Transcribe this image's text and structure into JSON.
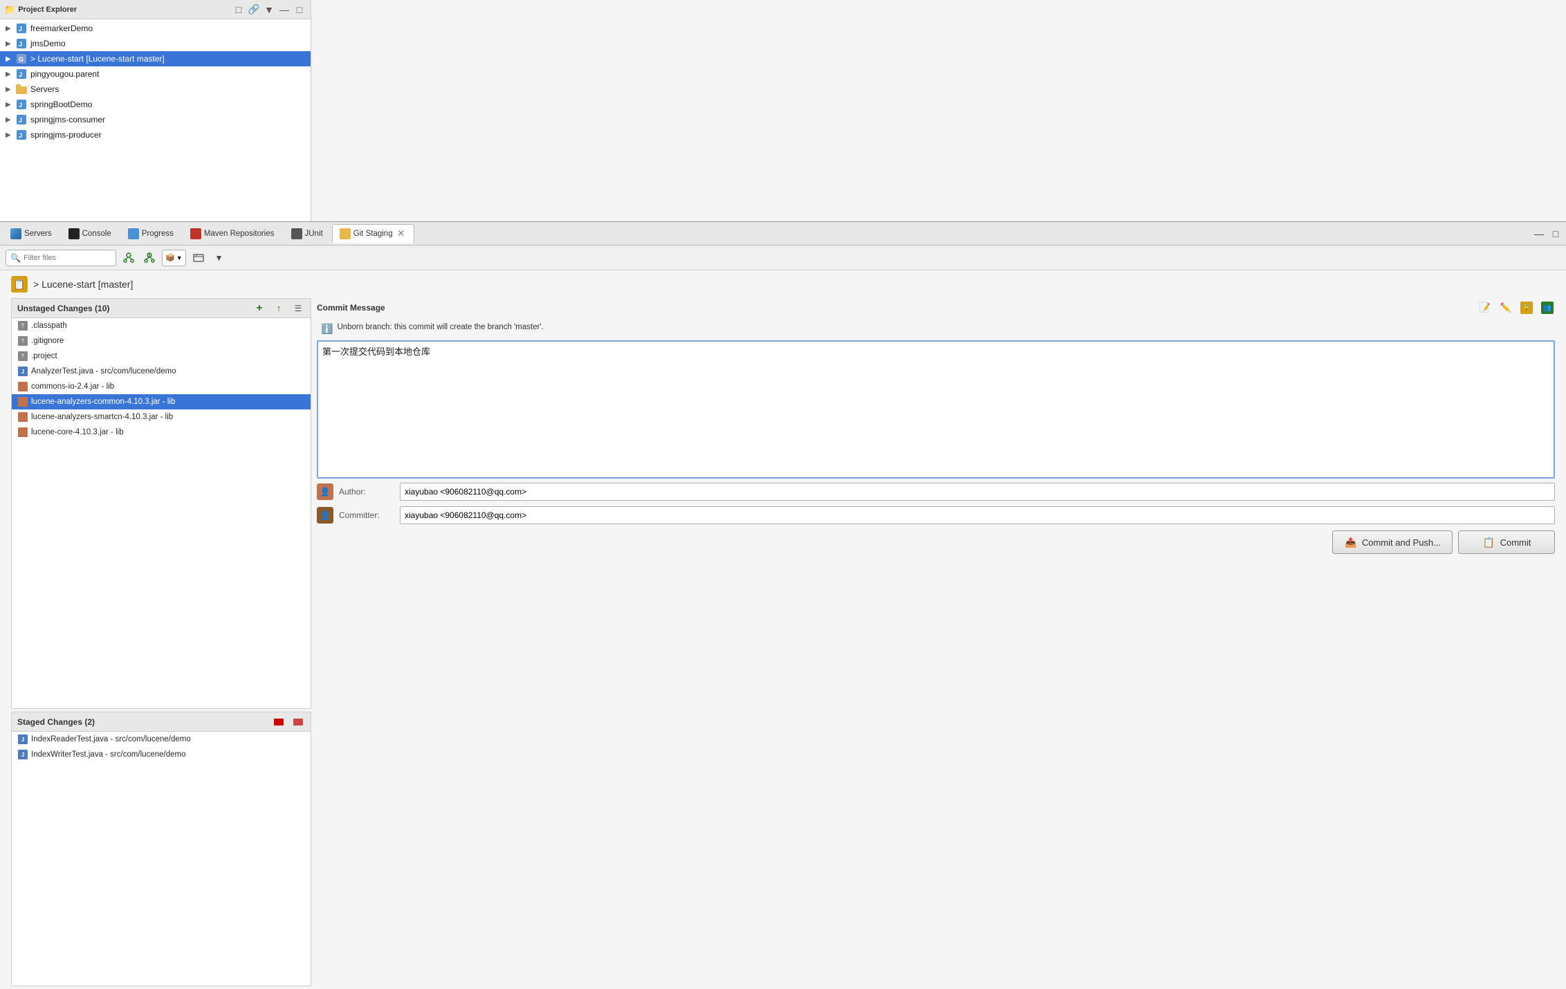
{
  "projectExplorer": {
    "title": "Project Explorer",
    "items": [
      {
        "label": "freemarkerDemo",
        "type": "project",
        "expanded": false
      },
      {
        "label": "jmsDemo",
        "type": "project",
        "expanded": false
      },
      {
        "label": "> Lucene-start [Lucene-start master]",
        "type": "git-project",
        "expanded": false,
        "selected": true
      },
      {
        "label": "pingyougou.parent",
        "type": "project",
        "expanded": false
      },
      {
        "label": "Servers",
        "type": "folder",
        "expanded": false
      },
      {
        "label": "springBootDemo",
        "type": "project",
        "expanded": false
      },
      {
        "label": "springjms-consumer",
        "type": "project",
        "expanded": false
      },
      {
        "label": "springjms-producer",
        "type": "project",
        "expanded": false
      }
    ]
  },
  "tabs": [
    {
      "label": "Servers",
      "type": "servers",
      "active": false
    },
    {
      "label": "Console",
      "type": "console",
      "active": false
    },
    {
      "label": "Progress",
      "type": "progress",
      "active": false
    },
    {
      "label": "Maven Repositories",
      "type": "maven",
      "active": false
    },
    {
      "label": "JUnit",
      "type": "junit",
      "active": false
    },
    {
      "label": "Git Staging",
      "type": "gitstaging",
      "active": true
    }
  ],
  "toolbar": {
    "filterPlaceholder": "Filter files",
    "minimizeLabel": "Minimize",
    "maximizeLabel": "Maximize"
  },
  "branchHeader": {
    "label": "> Lucene-start [master]"
  },
  "unstagedChanges": {
    "title": "Unstaged Changes (10)",
    "files": [
      {
        "name": ".classpath",
        "type": "txt"
      },
      {
        "name": ".gitignore",
        "type": "txt"
      },
      {
        "name": ".project",
        "type": "txt"
      },
      {
        "name": "AnalyzerTest.java - src/com/lucene/demo",
        "type": "java"
      },
      {
        "name": "commons-io-2.4.jar - lib",
        "type": "jar"
      },
      {
        "name": "lucene-analyzers-common-4.10.3.jar - lib",
        "type": "jar",
        "selected": true
      },
      {
        "name": "lucene-analyzers-smartcn-4.10.3.jar - lib",
        "type": "jar"
      },
      {
        "name": "lucene-core-4.10.3.jar - lib",
        "type": "jar"
      }
    ]
  },
  "stagedChanges": {
    "title": "Staged Changes (2)",
    "files": [
      {
        "name": "IndexReaderTest.java - src/com/lucene/demo",
        "type": "java"
      },
      {
        "name": "IndexWriterTest.java - src/com/lucene/demo",
        "type": "java"
      }
    ]
  },
  "commitMessage": {
    "title": "Commit Message",
    "infoBanner": "Unborn branch: this commit will create the branch 'master'.",
    "messageText": "第一次提交代码到本地仓库",
    "authorLabel": "Author:",
    "authorValue": "xiayubao <906082110@qq.com>",
    "committerLabel": "Committer:",
    "committerValue": "xiayubao <906082110@qq.com>",
    "commitAndPushLabel": "Commit and Push...",
    "commitLabel": "Commit"
  }
}
